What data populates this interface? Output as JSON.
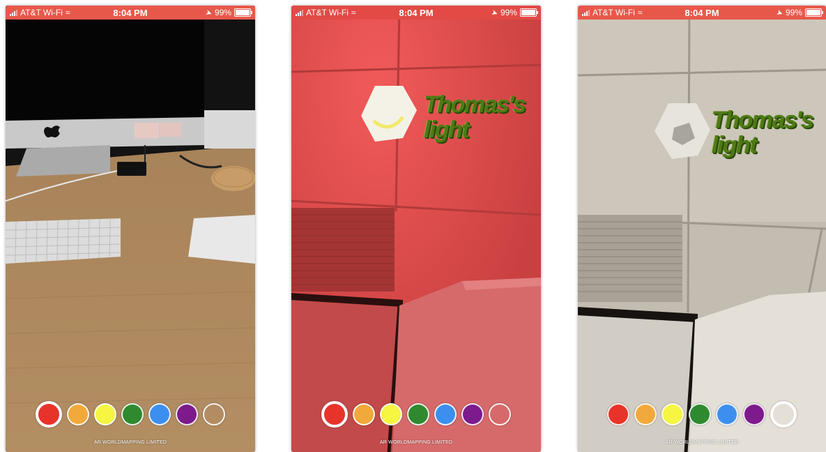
{
  "status_bar": {
    "carrier": "AT&T Wi-Fi",
    "time": "8:04 PM",
    "battery": "99%"
  },
  "palette": {
    "colors": [
      "#e8332a",
      "#f2a93b",
      "#f5f542",
      "#2f8a2f",
      "#3d8fef",
      "#7d1a8c",
      "transparent"
    ]
  },
  "screens": [
    {
      "id": "desk",
      "bar_color": "#e8584a",
      "selected_index": 0,
      "ar_label": "",
      "footer": "AR WORLDMAPPING LIMITED"
    },
    {
      "id": "red-light",
      "bar_color": "#e24a45",
      "selected_index": 0,
      "ar_label_line1": "Thomas's",
      "ar_label_line2": "light",
      "footer": "AR WORLDMAPPING LIMITED"
    },
    {
      "id": "off-light",
      "bar_color": "#e8584a",
      "selected_index": 6,
      "ar_label_line1": "Thomas's",
      "ar_label_line2": "light",
      "footer": "AR WORLDMAPPING LIMITED"
    }
  ]
}
